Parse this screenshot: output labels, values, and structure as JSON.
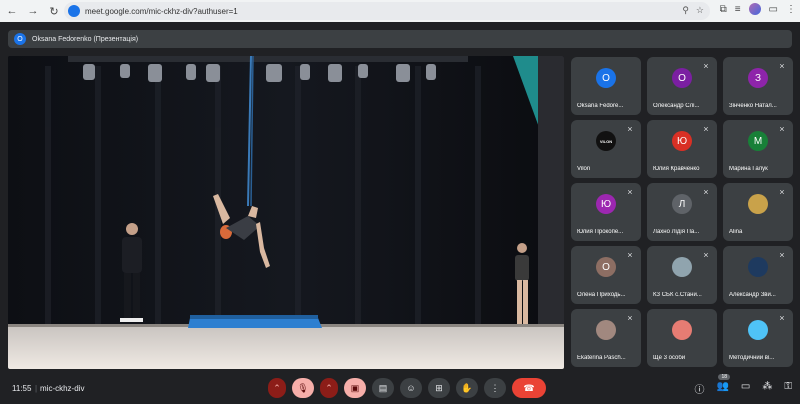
{
  "browser": {
    "url": "meet.google.com/mic-ckhz-div?authuser=1"
  },
  "presenter": {
    "initial": "O",
    "label": "Oksana Fedorenko (Презентація)"
  },
  "participants": [
    {
      "name": "Oksana Fedore...",
      "initial": "O",
      "color": "#1a73e8",
      "muted": false
    },
    {
      "name": "Олександр Слі...",
      "initial": "O",
      "color": "#7b1fa2",
      "muted": true
    },
    {
      "name": "Зінченко Натал...",
      "initial": "З",
      "color": "#8e24aa",
      "muted": true
    },
    {
      "name": "Vilon",
      "initial": "VILON",
      "color": "#111111",
      "muted": true
    },
    {
      "name": "Юлия Кравченко",
      "initial": "Ю",
      "color": "#d93025",
      "muted": true
    },
    {
      "name": "Марина Галук",
      "initial": "М",
      "color": "#188038",
      "muted": true
    },
    {
      "name": "Юлия Прокопе...",
      "initial": "Ю",
      "color": "#9c27b0",
      "muted": true
    },
    {
      "name": "Лахно Лідія Па...",
      "initial": "Л",
      "color": "#5f6368",
      "muted": true
    },
    {
      "name": "Alina",
      "initial": "",
      "color": "#c9a24a",
      "muted": true
    },
    {
      "name": "Олена Приходь...",
      "initial": "О",
      "color": "#8d6e63",
      "muted": true
    },
    {
      "name": "КЗ СБК с.Стани...",
      "initial": "",
      "color": "#90a4ae",
      "muted": true
    },
    {
      "name": "Александр Зви...",
      "initial": "",
      "color": "#1e3a5f",
      "muted": true
    },
    {
      "name": "Ekaterina Pasch...",
      "initial": "",
      "color": "#a1887f",
      "muted": true
    },
    {
      "name": "Ще 3 особи",
      "initial": "",
      "color": "#e67c73",
      "muted": false
    },
    {
      "name": "Методичний ві...",
      "initial": "",
      "color": "#4fc3f7",
      "muted": true
    }
  ],
  "bottom": {
    "time": "11:55",
    "separator": "|",
    "meeting_code": "mic-ckhz-div",
    "participant_count": "18"
  }
}
